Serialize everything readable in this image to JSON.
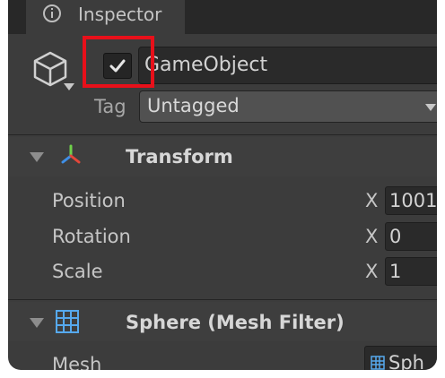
{
  "window": {
    "tab_label": "Inspector"
  },
  "object": {
    "name": "GameObject",
    "active": true,
    "tag_label": "Tag",
    "tag_value": "Untagged"
  },
  "components": [
    {
      "title": "Transform",
      "icon": "transform-axes-icon",
      "properties": [
        {
          "label": "Position",
          "axis": "X",
          "value": "1001"
        },
        {
          "label": "Rotation",
          "axis": "X",
          "value": "0"
        },
        {
          "label": "Scale",
          "axis": "X",
          "value": "1"
        }
      ]
    },
    {
      "title": "Sphere (Mesh Filter)",
      "icon": "mesh-grid-icon",
      "properties": [
        {
          "label": "Mesh",
          "value": "Sph"
        }
      ]
    }
  ],
  "colors": {
    "panel_bg": "#3c3c3c",
    "highlight": "#e8101a",
    "field_bg": "#2a2a2a"
  }
}
